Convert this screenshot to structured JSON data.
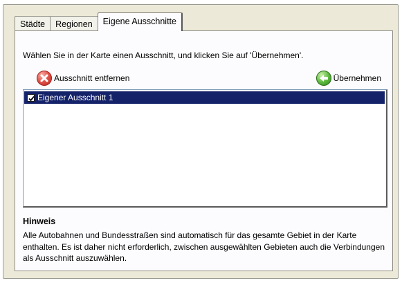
{
  "tabs": [
    {
      "label": "Städte",
      "active": false
    },
    {
      "label": "Regionen",
      "active": false
    },
    {
      "label": "Eigene Ausschnitte",
      "active": true
    }
  ],
  "instruction": "Wählen Sie in der Karte einen Ausschnitt, und klicken Sie auf 'Übernehmen'.",
  "actions": {
    "remove_label": "Ausschnitt entfernen",
    "remove_icon": "remove-x-icon",
    "apply_label": "Übernehmen",
    "apply_icon": "apply-arrow-icon"
  },
  "list": {
    "items": [
      {
        "label": "Eigener Ausschnitt 1",
        "checked": true,
        "selected": true
      }
    ]
  },
  "hint": {
    "title": "Hinweis",
    "text": "Alle Autobahnen und Bundesstraßen sind automatisch für das gesamte Gebiet in der Karte enthalten. Es ist daher nicht erforderlich, zwischen ausgewählten Gebieten auch die Verbindungen als Ausschnitt auszuwählen."
  },
  "colors": {
    "selection": "#14226a",
    "dialog_bg": "#ece9d8",
    "remove_red": "#e0524a",
    "apply_green": "#5cb83e"
  }
}
